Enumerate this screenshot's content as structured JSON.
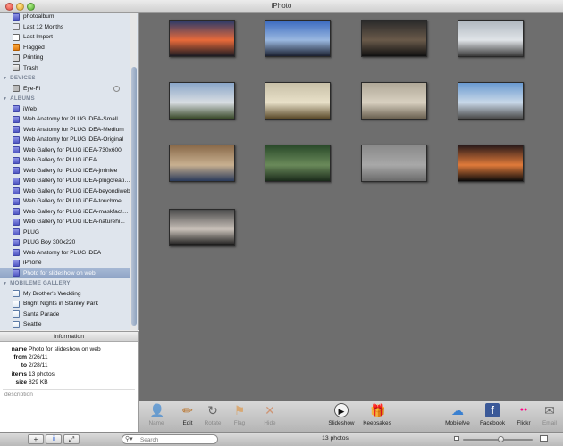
{
  "window": {
    "title": "iPhoto"
  },
  "sidebar": {
    "library_items": [
      {
        "label": "photoalbum",
        "icon": "album-icon"
      },
      {
        "label": "Last 12 Months",
        "icon": "calendar-icon"
      },
      {
        "label": "Last Import",
        "icon": "import-icon"
      },
      {
        "label": "Flagged",
        "icon": "flag-icon"
      },
      {
        "label": "Printing",
        "icon": "printer-icon"
      },
      {
        "label": "Trash",
        "icon": "trash-icon"
      }
    ],
    "devices_header": "DEVICES",
    "devices": [
      {
        "label": "Eye-Fi",
        "icon": "camera-device-icon"
      }
    ],
    "albums_header": "ALBUMS",
    "albums": [
      "iWeb",
      "Web Anatomy for PLUG iDEA-Small",
      "Web Anatomy for PLUG iDEA-Medium",
      "Web Anatomy for PLUG iDEA-Original",
      "Web Gallery for PLUG iDEA-730x600",
      "Web Gallery for PLUG iDEA",
      "Web Gallery for PLUG iDEA-jminlee",
      "Web Gallery for PLUG iDEA-plugcreative",
      "Web Gallery for PLUG iDEA-beyondiweb",
      "Web Gallery for PLUG iDEA-touchme...",
      "Web Gallery for PLUG iDEA-maskfactory",
      "Web Gallery for PLUG iDEA-naturehi...",
      "PLUG",
      "PLUG Boy 300x220",
      "Web Anatomy for PLUG iDEA",
      "iPhone",
      "Photo for slideshow on web"
    ],
    "selected_album": "Photo for slideshow on web",
    "mobileme_header": "MOBILEME GALLERY",
    "mobileme": [
      "My Brother's Wedding",
      "Bright Nights in Stanley Park",
      "Santa Parade",
      "Seattle"
    ]
  },
  "info": {
    "header": "Information",
    "rows": [
      {
        "key": "name",
        "value": "Photo for slideshow on web"
      },
      {
        "key": "from",
        "value": "2/26/11"
      },
      {
        "key": "to",
        "value": "2/28/11"
      },
      {
        "key": "items",
        "value": "13 photos"
      },
      {
        "key": "size",
        "value": "829 KB"
      }
    ],
    "description_placeholder": "description"
  },
  "photos": [
    {
      "colors": [
        "#2a3a6a",
        "#e86a3a",
        "#1a1a22"
      ]
    },
    {
      "colors": [
        "#3a6ac0",
        "#9ab8e0",
        "#1a2030"
      ]
    },
    {
      "colors": [
        "#2a2a2a",
        "#6a5a4a",
        "#101010"
      ]
    },
    {
      "colors": [
        "#b0b8c0",
        "#e0e4e8",
        "#3a3a3a"
      ]
    },
    {
      "colors": [
        "#8aa6c8",
        "#d8dde2",
        "#3a4a2a"
      ]
    },
    {
      "colors": [
        "#c8c0a8",
        "#e8e0c8",
        "#5a4a2a"
      ]
    },
    {
      "colors": [
        "#b0a898",
        "#d8d0c0",
        "#6a6050"
      ]
    },
    {
      "colors": [
        "#6a9ad0",
        "#c8d8e8",
        "#4a4a4a"
      ]
    },
    {
      "colors": [
        "#8a6a4a",
        "#c8b090",
        "#2a3a5a"
      ]
    },
    {
      "colors": [
        "#2a4a2a",
        "#6a8a5a",
        "#1a2a1a"
      ]
    },
    {
      "colors": [
        "#8a8a8a",
        "#a8a8a8",
        "#6a6a6a"
      ]
    },
    {
      "colors": [
        "#2a1a1a",
        "#e07a3a",
        "#0a0a0a"
      ]
    },
    {
      "colors": [
        "#4a4a4a",
        "#c8c0b8",
        "#1a1a1a"
      ]
    }
  ],
  "toolbar": {
    "buttons": [
      {
        "label": "Name",
        "icon": "name-icon",
        "glyph": "👤",
        "enabled": false
      },
      {
        "label": "Edit",
        "icon": "edit-pencil-icon",
        "glyph": "✏",
        "enabled": true
      },
      {
        "label": "Rotate",
        "icon": "rotate-icon",
        "glyph": "↻",
        "enabled": false
      },
      {
        "label": "Flag",
        "icon": "flag-icon",
        "glyph": "⚑",
        "enabled": false
      },
      {
        "label": "Hide",
        "icon": "hide-x-icon",
        "glyph": "✕",
        "enabled": false
      },
      {
        "label": "Slideshow",
        "icon": "slideshow-play-icon",
        "glyph": "▶",
        "enabled": true
      },
      {
        "label": "Keepsakes",
        "icon": "keepsakes-icon",
        "glyph": "🎁",
        "enabled": true
      },
      {
        "label": "MobileMe",
        "icon": "mobileme-cloud-icon",
        "glyph": "☁",
        "enabled": true
      },
      {
        "label": "Facebook",
        "icon": "facebook-icon",
        "glyph": "f",
        "enabled": true
      },
      {
        "label": "Flickr",
        "icon": "flickr-icon",
        "glyph": "●●",
        "enabled": true
      },
      {
        "label": "Email",
        "icon": "email-icon",
        "glyph": "✉",
        "enabled": false
      }
    ]
  },
  "bottombar": {
    "add_label": "+",
    "info_label": "i",
    "fullscreen_label": "⤢",
    "search_placeholder": "Search",
    "photo_count": "13 photos",
    "zoom_level": 0.55
  }
}
